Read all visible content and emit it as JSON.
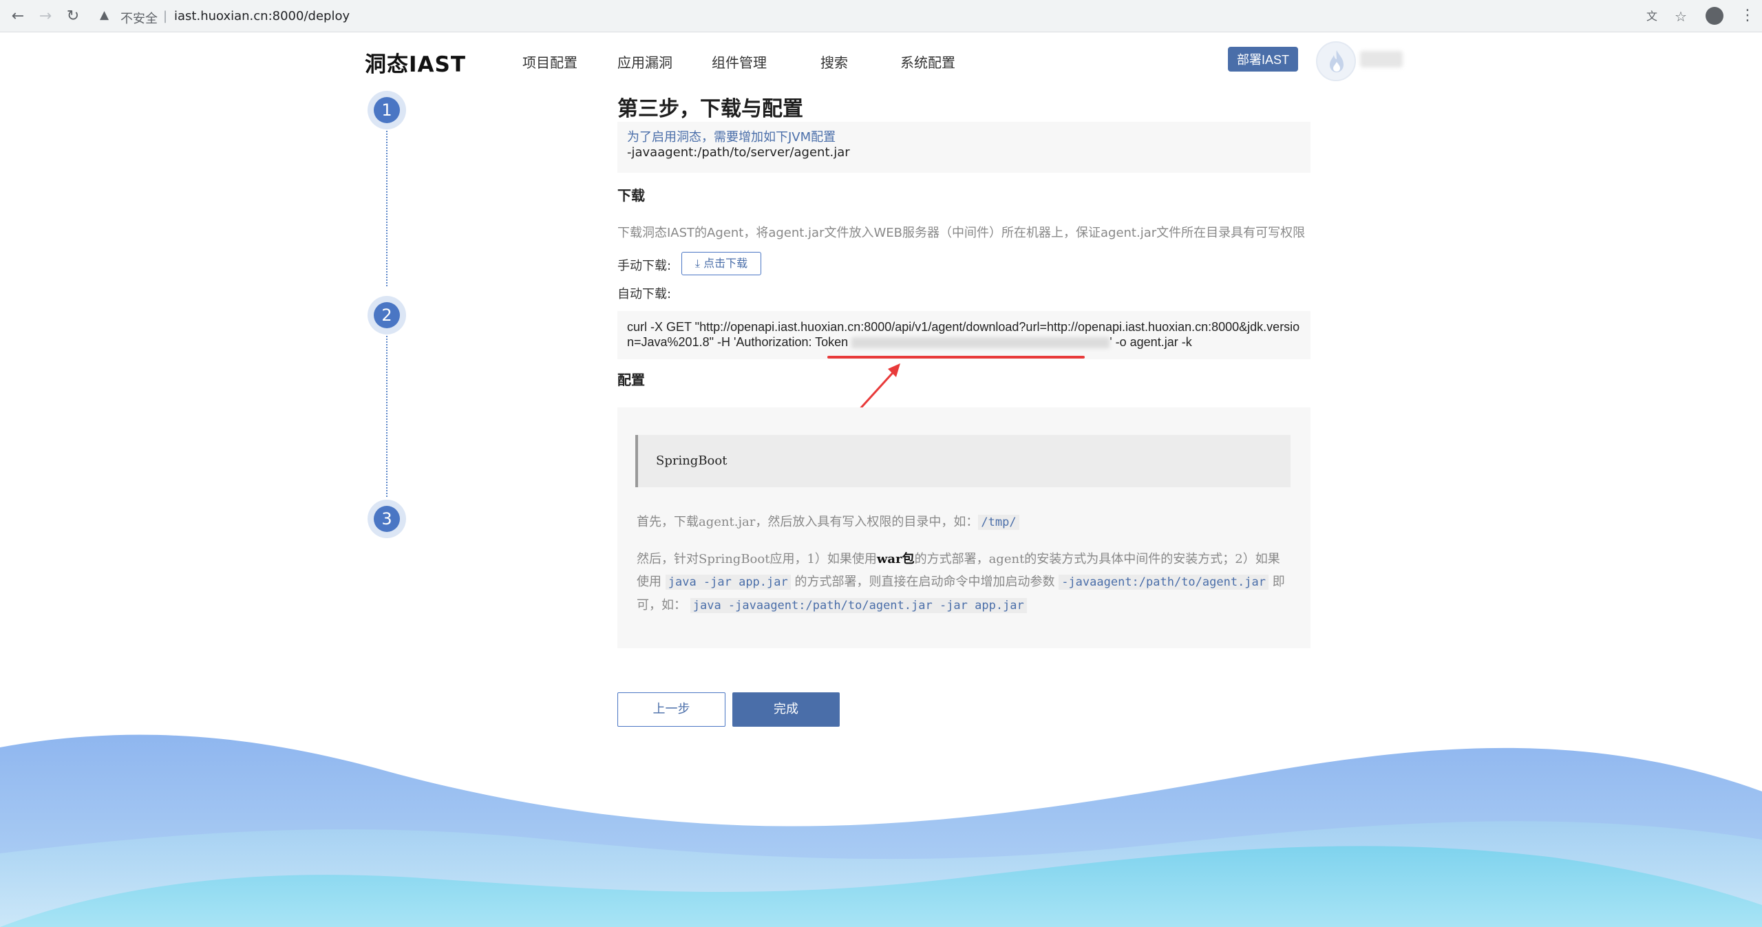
{
  "browser": {
    "insecure_label": "不安全",
    "separator": "|",
    "url": "iast.huoxian.cn:8000/deploy"
  },
  "header": {
    "logo": "洞态IAST",
    "nav": [
      "项目配置",
      "应用漏洞",
      "组件管理",
      "搜索",
      "系统配置"
    ],
    "deploy_button": "部署IAST"
  },
  "steps": [
    "1",
    "2",
    "3"
  ],
  "main": {
    "title": "第三步，下载与配置",
    "tip_line1": "为了启用洞态，需要增加如下JVM配置",
    "tip_line2": "-javaagent:/path/to/server/agent.jar",
    "download_title": "下载",
    "download_desc": "下载洞态IAST的Agent，将agent.jar文件放入WEB服务器（中间件）所在机器上，保证agent.jar文件所在目录具有可写权限",
    "manual_label": "手动下载:",
    "manual_button": "⤓ 点击下载",
    "auto_label": "自动下载:",
    "cmd_pre": "curl -X GET \"http://openapi.iast.huoxian.cn:8000/api/v1/agent/download?url=http://openapi.iast.huoxian.cn:8000&jdk.version=Java%201.8\" -H 'Authorization: Token ",
    "cmd_post": "' -o agent.jar -k",
    "config_title": "配置",
    "springboot": "SpringBoot",
    "p1_text": "首先，下载agent.jar，然后放入具有写入权限的目录中，如：",
    "p1_code": "/tmp/",
    "p2_a": "然后，针对SpringBoot应用，1）如果使用",
    "p2_bold": "war包",
    "p2_b": "的方式部署，agent的安装方式为具体中间件的安装方式；2）如果使用",
    "p2_code1": "java -jar app.jar",
    "p2_c": "的方式部署，则直接在启动命令中增加启动参数",
    "p2_code2": "-javaagent:/path/to/agent.jar",
    "p2_d": "即可，如：",
    "p2_code3": "java -javaagent:/path/to/agent.jar -jar app.jar",
    "prev_button": "上一步",
    "done_button": "完成"
  },
  "colors": {
    "accent": "#4a6ea9",
    "step": "#4a76c4",
    "annotation": "#e83a3a"
  }
}
